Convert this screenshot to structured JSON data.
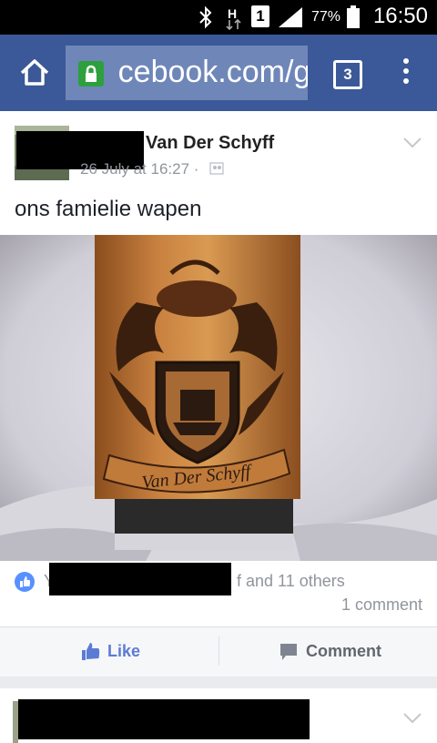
{
  "status_bar": {
    "time": "16:50",
    "battery_percent": "77%",
    "sim_slot": "1",
    "network_type": "H",
    "icons": [
      "bluetooth-icon",
      "data-transfer-icon",
      "sim-icon",
      "signal-icon",
      "battery-icon"
    ]
  },
  "browser": {
    "url_text": " cebook.com/g",
    "tab_count": "3",
    "colors": {
      "toolbar": "#3b5998",
      "url_field": "#6f86b8",
      "lock": "#2e9f3d"
    }
  },
  "post": {
    "author": "Van Der Schyff",
    "timestamp": "26 July at 16:27 ·",
    "privacy_icon": "friends-icon",
    "text": "ons famielie wapen",
    "photo": {
      "inscription": "Van Der Schyff"
    },
    "reactions": {
      "prefix": "Y",
      "others_text": "f and 11 others",
      "comments_text": "1 comment"
    },
    "actions": {
      "like_label": "Like",
      "comment_label": "Comment"
    }
  }
}
